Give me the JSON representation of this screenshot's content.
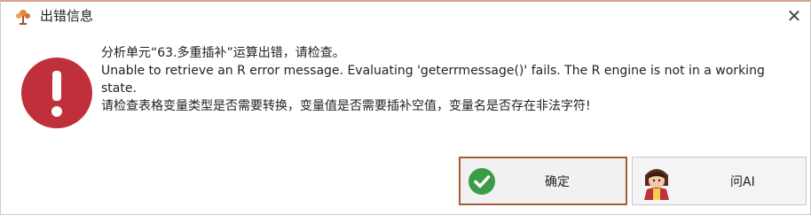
{
  "window": {
    "title": "出错信息",
    "close_symbol": "✕"
  },
  "icons": {
    "app": "tree-logo-icon",
    "error": "error-exclamation-icon",
    "ok": "green-check-icon",
    "ai": "ai-avatar-icon"
  },
  "colors": {
    "error_red": "#c0303a",
    "ok_green": "#3a9c47",
    "focus_border": "#a85a38",
    "title_accent": "#d9a08a"
  },
  "message": {
    "line1": "分析单元“63.多重插补”运算出错，请检查。",
    "line2": "Unable to retrieve an R error message. Evaluating 'geterrmessage()' fails. The R engine is not in a working state.",
    "line3": "请检查表格变量类型是否需要转换，变量值是否需要插补空值，变量名是否存在非法字符!"
  },
  "buttons": {
    "ok_label": "确定",
    "ai_label": "问AI"
  }
}
